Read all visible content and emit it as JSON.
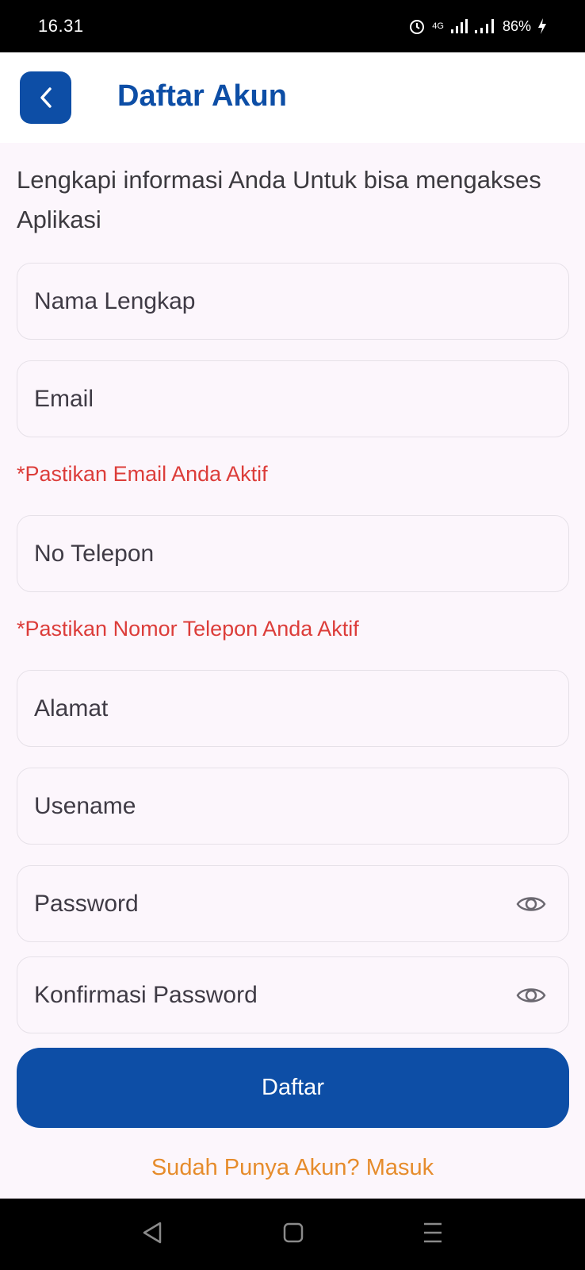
{
  "status_bar": {
    "time": "16.31",
    "network": "4G",
    "battery": "86%"
  },
  "header": {
    "title": "Daftar Akun",
    "back_icon": "chevron-left-icon"
  },
  "intro": "Lengkapi informasi Anda Untuk bisa mengakses Aplikasi",
  "fields": {
    "full_name": {
      "placeholder": "Nama Lengkap"
    },
    "email": {
      "placeholder": "Email"
    },
    "email_warning": "*Pastikan Email Anda Aktif",
    "phone": {
      "placeholder": "No Telepon"
    },
    "phone_warning": "*Pastikan Nomor Telepon Anda Aktif",
    "address": {
      "placeholder": "Alamat"
    },
    "username": {
      "placeholder": "Usename"
    },
    "password": {
      "placeholder": "Password",
      "icon": "eye-icon"
    },
    "confirm_password": {
      "placeholder": "Konfirmasi Password",
      "icon": "eye-icon"
    }
  },
  "submit_label": "Daftar",
  "login_link": "Sudah Punya Akun? Masuk",
  "colors": {
    "primary": "#0d4ea6",
    "warning": "#dc3d3a",
    "link": "#e68c2c",
    "background": "#fcf6fc"
  }
}
